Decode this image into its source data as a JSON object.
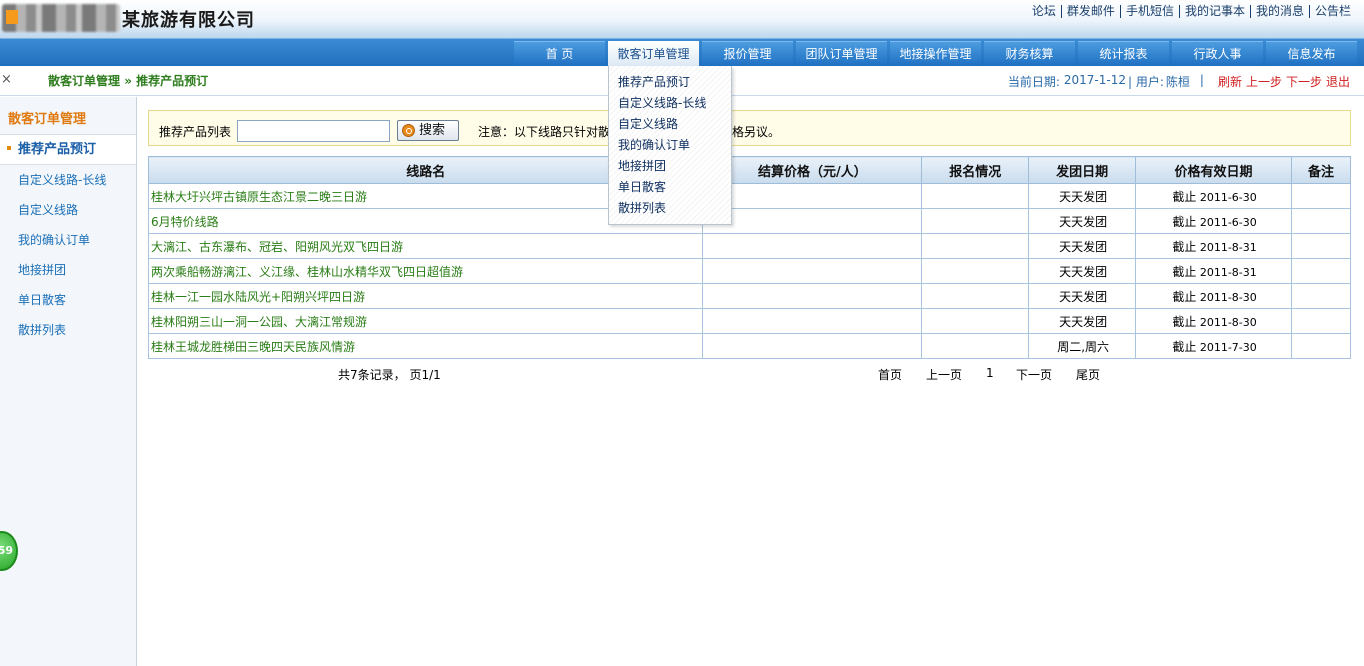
{
  "company": {
    "name": "某旅游有限公司"
  },
  "top_links": [
    "论坛",
    "群发邮件",
    "手机短信",
    "我的记事本",
    "我的消息",
    "公告栏"
  ],
  "nav": [
    "首 页",
    "散客订单管理",
    "报价管理",
    "团队订单管理",
    "地接操作管理",
    "财务核算",
    "统计报表",
    "行政人事",
    "信息发布"
  ],
  "nav_active": 1,
  "breadcrumb": {
    "section": "散客订单管理",
    "separator": "»",
    "page": "推荐产品预订"
  },
  "status": {
    "date_label": "当前日期:",
    "date": "2017-1-12",
    "user_label": "| 用户:",
    "user": "陈桓",
    "pipe": "|",
    "refresh": "刷新",
    "prev": "上一步",
    "next": "下一步",
    "logout": "退出"
  },
  "sidebar": {
    "title": "散客订单管理",
    "current": "推荐产品预订",
    "items": [
      "自定义线路-长线",
      "自定义线路",
      "我的确认订单",
      "地接拼团",
      "单日散客",
      "散拼列表"
    ]
  },
  "badge": "59",
  "search": {
    "label": "推荐产品列表",
    "value": "",
    "button": "搜索",
    "notice_head": "注意：以下线路只针对散",
    "notice_tail": "格另议。"
  },
  "table": {
    "headers": [
      "线路名",
      "结算价格（元/人）",
      "报名情况",
      "发团日期",
      "价格有效日期",
      "备注"
    ],
    "rows": [
      {
        "name": "桂林大圩兴坪古镇原生态江景二晚三日游",
        "price": "",
        "signup": "",
        "departure": "天天发团",
        "valid_prefix": "截止",
        "valid_date": "2011-6-30",
        "remark": ""
      },
      {
        "name": "6月特价线路",
        "price": "",
        "signup": "",
        "departure": "天天发团",
        "valid_prefix": "截止",
        "valid_date": "2011-6-30",
        "remark": ""
      },
      {
        "name": "大漓江、古东瀑布、冠岩、阳朔风光双飞四日游",
        "price": "",
        "signup": "",
        "departure": "天天发团",
        "valid_prefix": "截止",
        "valid_date": "2011-8-31",
        "remark": ""
      },
      {
        "name": "两次乘船畅游漓江、义江缘、桂林山水精华双飞四日超值游",
        "price": "",
        "signup": "",
        "departure": "天天发团",
        "valid_prefix": "截止",
        "valid_date": "2011-8-31",
        "remark": ""
      },
      {
        "name": "桂林一江一园水陆风光+阳朔兴坪四日游",
        "price": "",
        "signup": "",
        "departure": "天天发团",
        "valid_prefix": "截止",
        "valid_date": "2011-8-30",
        "remark": ""
      },
      {
        "name": "桂林阳朔三山一洞一公园、大漓江常规游",
        "price": "",
        "signup": "",
        "departure": "天天发团",
        "valid_prefix": "截止",
        "valid_date": "2011-8-30",
        "remark": ""
      },
      {
        "name": "桂林王城龙胜梯田三晚四天民族风情游",
        "price": "",
        "signup": "",
        "departure": "周二,周六",
        "valid_prefix": "截止",
        "valid_date": "2011-7-30",
        "remark": ""
      }
    ]
  },
  "pager": {
    "summary": "共7条记录， 页1/1",
    "first": "首页",
    "prev": "上一页",
    "current": "1",
    "next": "下一页",
    "last": "尾页"
  },
  "dropdown": [
    "推荐产品预订",
    "自定义线路-长线",
    "自定义线路",
    "我的确认订单",
    "地接拼团",
    "单日散客",
    "散拼列表"
  ],
  "icons": {
    "close": "close-icon",
    "search": "search-icon",
    "bullet": "bullet-icon"
  },
  "colors": {
    "accent_blue": "#1f6fbf",
    "link_green": "#2a7d16",
    "side_title_orange": "#e07a10",
    "alert_red": "#d02020"
  }
}
